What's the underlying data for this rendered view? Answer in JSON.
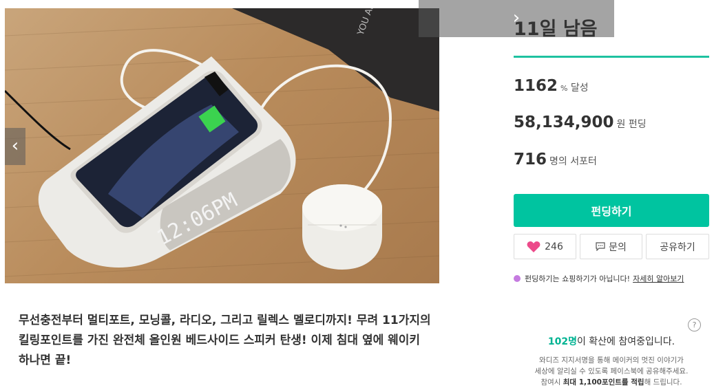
{
  "hero": {
    "clock_display": "12:06PM",
    "magazine_text": "YOU ARE"
  },
  "description": {
    "lines": [
      "무선충전부터 멀티포트, 모닝콜, 라디오, 그리고 릴렉스 멜로디까지! 무려 11가지의",
      "킬링포인트를 가진 완전체 올인원 베드사이드 스피커 탄생! 이제 침대 옆에 웨이키",
      "하나면 끝!"
    ]
  },
  "campaign": {
    "days_left": "11일 남음",
    "percent": "1162",
    "percent_unit_sign": "%",
    "percent_unit": "달성",
    "amount": "58,134,900",
    "amount_unit": "원 펀딩",
    "supporters": "716",
    "supporters_unit": "명의 서포터"
  },
  "actions": {
    "fund_label": "펀딩하기",
    "like_count": "246",
    "inquiry_label": "문의",
    "share_label": "공유하기"
  },
  "notice": {
    "text": "펀딩하기는 쇼핑하기가 아닙니다!",
    "link": "자세히 알아보기"
  },
  "spread": {
    "help_label": "?",
    "count": "102명",
    "text": "이 확산에 참여중입니다.",
    "note_line1": "와디즈 지지서명을 통해 메이커의 멋진 이야기가",
    "note_line2": "세상에 알리실 수 있도록 페이스북에 공유해주세요.",
    "note_line3_a": "참여시 ",
    "note_line3_b": "최대 1,100포인트를 적립",
    "note_line3_c": "해 드립니다."
  },
  "colors": {
    "accent": "#00c4a0",
    "heart": "#ec4a8a",
    "info_dot": "#c57be0"
  },
  "icons": {
    "prev": "chevron-left-icon",
    "next": "chevron-right-icon",
    "like": "heart-icon",
    "inquiry": "chat-icon",
    "notice": "info-dot-icon",
    "help": "question-icon"
  }
}
